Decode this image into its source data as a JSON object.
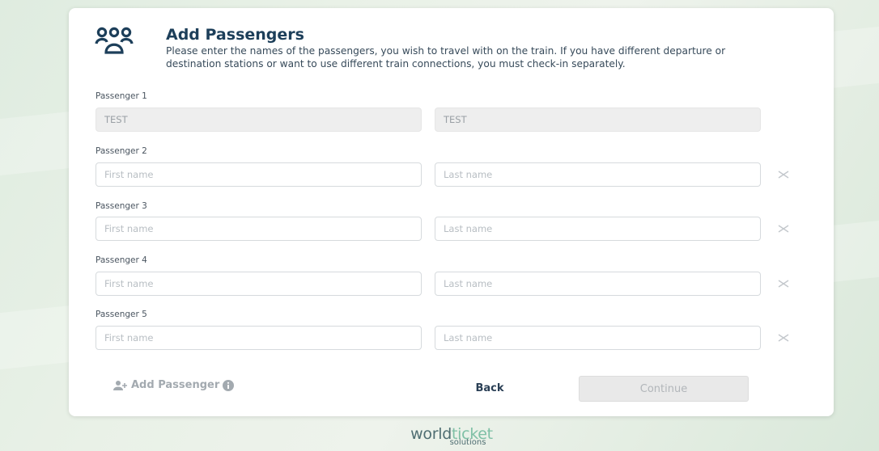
{
  "header": {
    "title": "Add Passengers",
    "description": "Please enter the names of the passengers, you wish to travel with on the train. If you have different departure or destination stations or want to use different train connections, you must check-in separately.",
    "icon": "passengers-group-icon"
  },
  "passengers": [
    {
      "label": "Passenger 1",
      "first_value": "TEST",
      "last_value": "TEST"
    },
    {
      "label": "Passenger 2",
      "first_placeholder": "First name",
      "last_placeholder": "Last name"
    },
    {
      "label": "Passenger 3",
      "first_placeholder": "First name",
      "last_placeholder": "Last name"
    },
    {
      "label": "Passenger 4",
      "first_placeholder": "First name",
      "last_placeholder": "Last name"
    },
    {
      "label": "Passenger 5",
      "first_placeholder": "First name",
      "last_placeholder": "Last name"
    }
  ],
  "actions": {
    "add_passenger": "Add Passenger",
    "back": "Back",
    "continue": "Continue"
  },
  "logo": {
    "part1": "world",
    "part2": "ticket",
    "sub": "solutions"
  },
  "colors": {
    "title": "#1d3f5a",
    "disabled_button": "#e9e9e9",
    "accent": "#7fc0a6"
  }
}
